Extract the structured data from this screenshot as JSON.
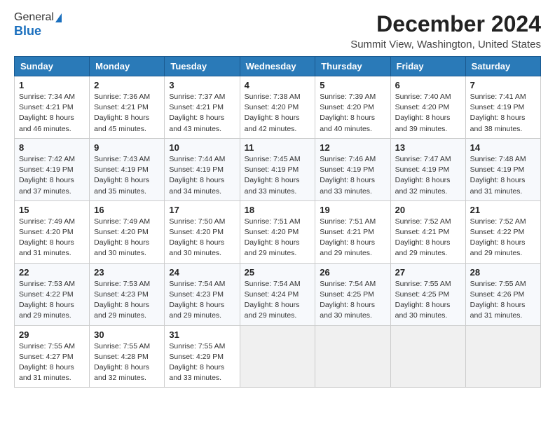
{
  "header": {
    "logo_general": "General",
    "logo_blue": "Blue",
    "title": "December 2024",
    "subtitle": "Summit View, Washington, United States"
  },
  "calendar": {
    "columns": [
      "Sunday",
      "Monday",
      "Tuesday",
      "Wednesday",
      "Thursday",
      "Friday",
      "Saturday"
    ],
    "weeks": [
      [
        {
          "day": "1",
          "sunrise": "7:34 AM",
          "sunset": "4:21 PM",
          "daylight": "8 hours and 46 minutes."
        },
        {
          "day": "2",
          "sunrise": "7:36 AM",
          "sunset": "4:21 PM",
          "daylight": "8 hours and 45 minutes."
        },
        {
          "day": "3",
          "sunrise": "7:37 AM",
          "sunset": "4:21 PM",
          "daylight": "8 hours and 43 minutes."
        },
        {
          "day": "4",
          "sunrise": "7:38 AM",
          "sunset": "4:20 PM",
          "daylight": "8 hours and 42 minutes."
        },
        {
          "day": "5",
          "sunrise": "7:39 AM",
          "sunset": "4:20 PM",
          "daylight": "8 hours and 40 minutes."
        },
        {
          "day": "6",
          "sunrise": "7:40 AM",
          "sunset": "4:20 PM",
          "daylight": "8 hours and 39 minutes."
        },
        {
          "day": "7",
          "sunrise": "7:41 AM",
          "sunset": "4:19 PM",
          "daylight": "8 hours and 38 minutes."
        }
      ],
      [
        {
          "day": "8",
          "sunrise": "7:42 AM",
          "sunset": "4:19 PM",
          "daylight": "8 hours and 37 minutes."
        },
        {
          "day": "9",
          "sunrise": "7:43 AM",
          "sunset": "4:19 PM",
          "daylight": "8 hours and 35 minutes."
        },
        {
          "day": "10",
          "sunrise": "7:44 AM",
          "sunset": "4:19 PM",
          "daylight": "8 hours and 34 minutes."
        },
        {
          "day": "11",
          "sunrise": "7:45 AM",
          "sunset": "4:19 PM",
          "daylight": "8 hours and 33 minutes."
        },
        {
          "day": "12",
          "sunrise": "7:46 AM",
          "sunset": "4:19 PM",
          "daylight": "8 hours and 33 minutes."
        },
        {
          "day": "13",
          "sunrise": "7:47 AM",
          "sunset": "4:19 PM",
          "daylight": "8 hours and 32 minutes."
        },
        {
          "day": "14",
          "sunrise": "7:48 AM",
          "sunset": "4:19 PM",
          "daylight": "8 hours and 31 minutes."
        }
      ],
      [
        {
          "day": "15",
          "sunrise": "7:49 AM",
          "sunset": "4:20 PM",
          "daylight": "8 hours and 31 minutes."
        },
        {
          "day": "16",
          "sunrise": "7:49 AM",
          "sunset": "4:20 PM",
          "daylight": "8 hours and 30 minutes."
        },
        {
          "day": "17",
          "sunrise": "7:50 AM",
          "sunset": "4:20 PM",
          "daylight": "8 hours and 30 minutes."
        },
        {
          "day": "18",
          "sunrise": "7:51 AM",
          "sunset": "4:20 PM",
          "daylight": "8 hours and 29 minutes."
        },
        {
          "day": "19",
          "sunrise": "7:51 AM",
          "sunset": "4:21 PM",
          "daylight": "8 hours and 29 minutes."
        },
        {
          "day": "20",
          "sunrise": "7:52 AM",
          "sunset": "4:21 PM",
          "daylight": "8 hours and 29 minutes."
        },
        {
          "day": "21",
          "sunrise": "7:52 AM",
          "sunset": "4:22 PM",
          "daylight": "8 hours and 29 minutes."
        }
      ],
      [
        {
          "day": "22",
          "sunrise": "7:53 AM",
          "sunset": "4:22 PM",
          "daylight": "8 hours and 29 minutes."
        },
        {
          "day": "23",
          "sunrise": "7:53 AM",
          "sunset": "4:23 PM",
          "daylight": "8 hours and 29 minutes."
        },
        {
          "day": "24",
          "sunrise": "7:54 AM",
          "sunset": "4:23 PM",
          "daylight": "8 hours and 29 minutes."
        },
        {
          "day": "25",
          "sunrise": "7:54 AM",
          "sunset": "4:24 PM",
          "daylight": "8 hours and 29 minutes."
        },
        {
          "day": "26",
          "sunrise": "7:54 AM",
          "sunset": "4:25 PM",
          "daylight": "8 hours and 30 minutes."
        },
        {
          "day": "27",
          "sunrise": "7:55 AM",
          "sunset": "4:25 PM",
          "daylight": "8 hours and 30 minutes."
        },
        {
          "day": "28",
          "sunrise": "7:55 AM",
          "sunset": "4:26 PM",
          "daylight": "8 hours and 31 minutes."
        }
      ],
      [
        {
          "day": "29",
          "sunrise": "7:55 AM",
          "sunset": "4:27 PM",
          "daylight": "8 hours and 31 minutes."
        },
        {
          "day": "30",
          "sunrise": "7:55 AM",
          "sunset": "4:28 PM",
          "daylight": "8 hours and 32 minutes."
        },
        {
          "day": "31",
          "sunrise": "7:55 AM",
          "sunset": "4:29 PM",
          "daylight": "8 hours and 33 minutes."
        },
        null,
        null,
        null,
        null
      ]
    ]
  }
}
